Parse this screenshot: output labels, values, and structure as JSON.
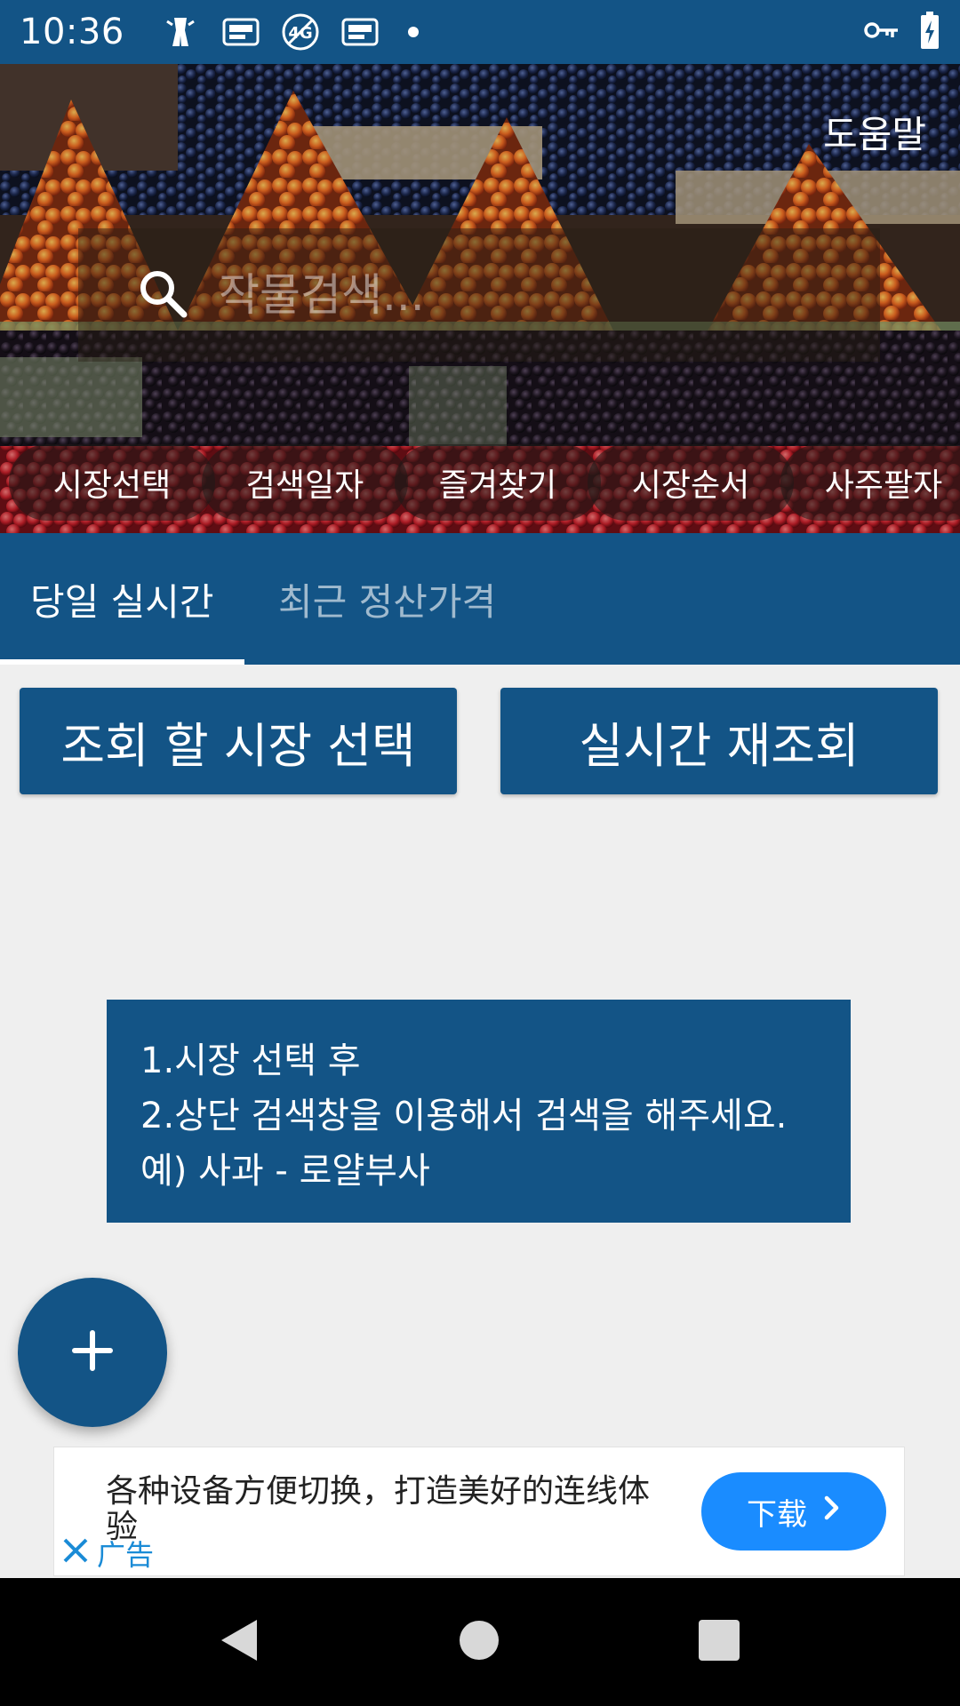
{
  "status_bar": {
    "time": "10:36",
    "icons": [
      "person-icon",
      "app-icon",
      "no-4g-icon",
      "app-icon",
      "dot-icon",
      "key-icon",
      "battery-charging-icon"
    ]
  },
  "hero": {
    "help_label": "도움말",
    "search": {
      "placeholder": "작물검색...",
      "value": ""
    },
    "chips": [
      "시장선택",
      "검색일자",
      "즐겨찾기",
      "시장순서",
      "사주팔자"
    ]
  },
  "tabs": [
    {
      "label": "당일 실시간",
      "active": true
    },
    {
      "label": "최근 정산가격",
      "active": false
    }
  ],
  "actions": {
    "select_market": "조회 할 시장 선택",
    "refresh": "실시간 재조회"
  },
  "info": {
    "line1": "1.시장 선택 후",
    "line2": "2.상단 검색창을 이용해서 검색을 해주세요.",
    "line3": "예) 사과 - 로얄부사"
  },
  "fab": {
    "icon": "plus-icon"
  },
  "ad": {
    "text": "各种设备方便切换，打造美好的连线体验",
    "label": "广告",
    "button": "下载"
  },
  "colors": {
    "primary": "#135486",
    "background": "#efefef",
    "ad_button": "#1a8cff"
  }
}
